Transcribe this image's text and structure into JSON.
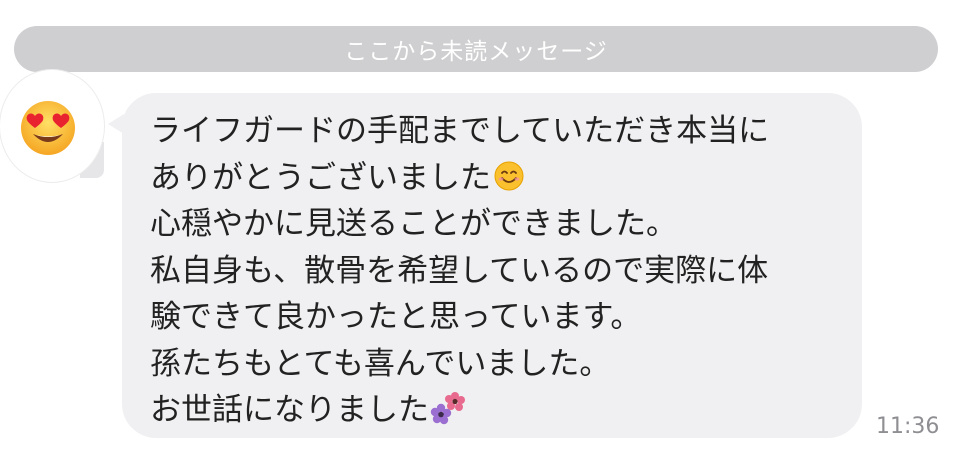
{
  "divider": {
    "text": "ここから未読メッセージ"
  },
  "sender": {
    "avatar_icon": "heart-eyes-emoji-icon"
  },
  "message": {
    "lines": [
      "ライフガードの手配までしていただき本当に",
      "ありがとうございました",
      "心穏やかに見送ることができました。",
      "私自身も、散骨を希望しているので実際に体",
      "験できて良かったと思っています。",
      "孫たちもとても喜んでいました。",
      "お世話になりました"
    ],
    "inline_icons": [
      "smiling-face-emoji-icon",
      "flowers-emoji-icon"
    ],
    "time": "11:36"
  },
  "colors": {
    "divider_bg": "#cfcfd1",
    "bubble_bg": "#f0f0f2",
    "text": "#222222",
    "time": "#8e8e93"
  }
}
